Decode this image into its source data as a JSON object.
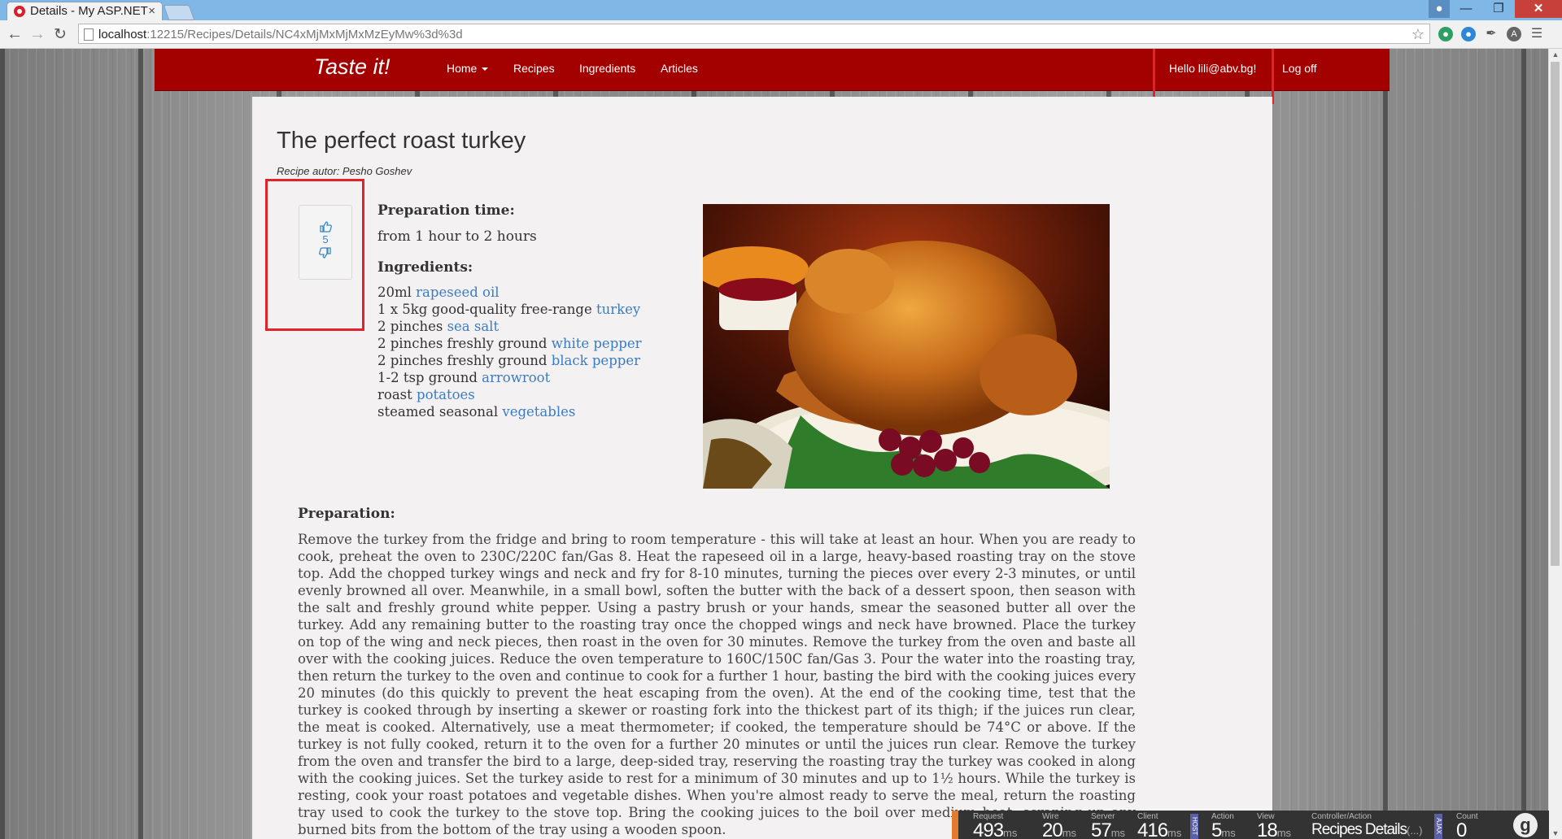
{
  "browser": {
    "tab_title": "Details - My ASP.NET",
    "tab_close": "×",
    "url_host": "localhost",
    "url_path": ":12215/Recipes/Details/NC4xMjMxMjMxMzEyMw%3d%3d"
  },
  "navbar": {
    "brand": "Taste it!",
    "links": [
      "Home",
      "Recipes",
      "Ingredients",
      "Articles"
    ],
    "greeting": "Hello lili@abv.bg!",
    "logoff": "Log off"
  },
  "recipe": {
    "title": "The perfect roast turkey",
    "author": "Recipe autor: Pesho Goshev",
    "votes": "5",
    "prep_time_heading": "Preparation time:",
    "prep_time": "from 1 hour to 2 hours",
    "ingredients_heading": "Ingredients:",
    "ingredients": [
      {
        "pre": "20ml ",
        "link": "rapeseed oil"
      },
      {
        "pre": "1 x 5kg good-quality free-range ",
        "link": "turkey"
      },
      {
        "pre": "2 pinches ",
        "link": "sea salt"
      },
      {
        "pre": "2 pinches freshly ground ",
        "link": "white pepper"
      },
      {
        "pre": "2 pinches freshly ground ",
        "link": "black pepper"
      },
      {
        "pre": "1-2 tsp ground ",
        "link": "arrowroot"
      },
      {
        "pre": "roast ",
        "link": "potatoes"
      },
      {
        "pre": "steamed seasonal ",
        "link": "vegetables"
      }
    ],
    "preparation_heading": "Preparation:",
    "preparation": "Remove the turkey from the fridge and bring to room temperature - this will take at least an hour. When you are ready to cook, preheat the oven to 230C/220C fan/Gas 8. Heat the rapeseed oil in a large, heavy-based roasting tray on the stove top. Add the chopped turkey wings and neck and fry for 8-10 minutes, turning the pieces over every 2-3 minutes, or until evenly browned all over. Meanwhile, in a small bowl, soften the butter with the back of a dessert spoon, then season with the salt and freshly ground white pepper. Using a pastry brush or your hands, smear the seasoned butter all over the turkey. Add any remaining butter to the roasting tray once the chopped wings and neck have browned. Place the turkey on top of the wing and neck pieces, then roast in the oven for 30 minutes. Remove the turkey from the oven and baste all over with the cooking juices. Reduce the oven temperature to 160C/150C fan/Gas 3. Pour the water into the roasting tray, then return the turkey to the oven and continue to cook for a further 1 hour, basting the bird with the cooking juices every 20 minutes (do this quickly to prevent the heat escaping from the oven). At the end of the cooking time, test that the turkey is cooked through by inserting a skewer or roasting fork into the thickest part of its thigh; if the juices run clear, the meat is cooked. Alternatively, use a meat thermometer; if cooked, the temperature should be 74°C or above. If the turkey is not fully cooked, return it to the oven for a further 20 minutes or until the juices run clear. Remove the turkey from the oven and transfer the bird to a large, deep-sided tray, reserving the roasting tray the turkey was cooked in along with the cooking juices. Set the turkey aside to rest for a minimum of 30 minutes and up to 1½ hours. While the turkey is resting, cook your roast potatoes and vegetable dishes. When you're almost ready to serve the meal, return the roasting tray used to cook the turkey to the stove top. Bring the cooking juices to the boil over medium heat, scraping up any burned bits from the bottom of the tray using a wooden spoon."
  },
  "glimpse": {
    "request_label": "Request",
    "request_value": "493",
    "request_unit": "ms",
    "wire_label": "Wire",
    "wire_value": "20",
    "wire_unit": "ms",
    "server_label": "Server",
    "server_value": "57",
    "server_unit": "ms",
    "client_label": "Client",
    "client_value": "416",
    "client_unit": "ms",
    "host_tag": "HOST",
    "action_label": "Action",
    "action_value": "5",
    "action_unit": "ms",
    "view_label": "View",
    "view_value": "18",
    "view_unit": "ms",
    "controller_label": "Controller/Action",
    "controller_value": "Recipes Details",
    "controller_suffix": "(...)",
    "ajax_tag": "AJAX",
    "count_label": "Count",
    "count_value": "0"
  },
  "colors": {
    "navbar": "#a30000",
    "highlight_box": "#e0232b",
    "link": "#3a7cc4",
    "panel": "#f3f1f2"
  }
}
